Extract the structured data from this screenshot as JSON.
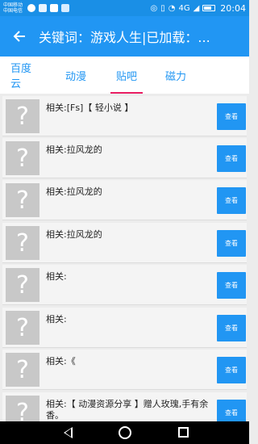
{
  "status": {
    "carrier1": "中国移动",
    "carrier2": "中国电信",
    "network": "4G",
    "time": "20:04"
  },
  "toolbar": {
    "title": "关键词：游戏人生|已加载：..."
  },
  "tabs": [
    {
      "label": "百度云",
      "active": false
    },
    {
      "label": "动漫",
      "active": false
    },
    {
      "label": "贴吧",
      "active": true
    },
    {
      "label": "磁力",
      "active": false
    }
  ],
  "list": {
    "items": [
      {
        "text": "相关:[Fs]【 轻小说 】",
        "button": "查看",
        "thumb": "?"
      },
      {
        "text": "相关:拉风龙的",
        "button": "查看",
        "thumb": "?"
      },
      {
        "text": "相关:拉风龙的",
        "button": "查看",
        "thumb": "?"
      },
      {
        "text": "相关:拉风龙的",
        "button": "查看",
        "thumb": "?"
      },
      {
        "text": "相关:",
        "button": "查看",
        "thumb": "?"
      },
      {
        "text": "相关:",
        "button": "查看",
        "thumb": "?"
      },
      {
        "text": "相关:《",
        "button": "查看",
        "thumb": "?"
      },
      {
        "text": "相关:【 动漫资源分享 】赠人玫瑰,手有余香。",
        "button": "查看",
        "thumb": "?"
      }
    ]
  }
}
